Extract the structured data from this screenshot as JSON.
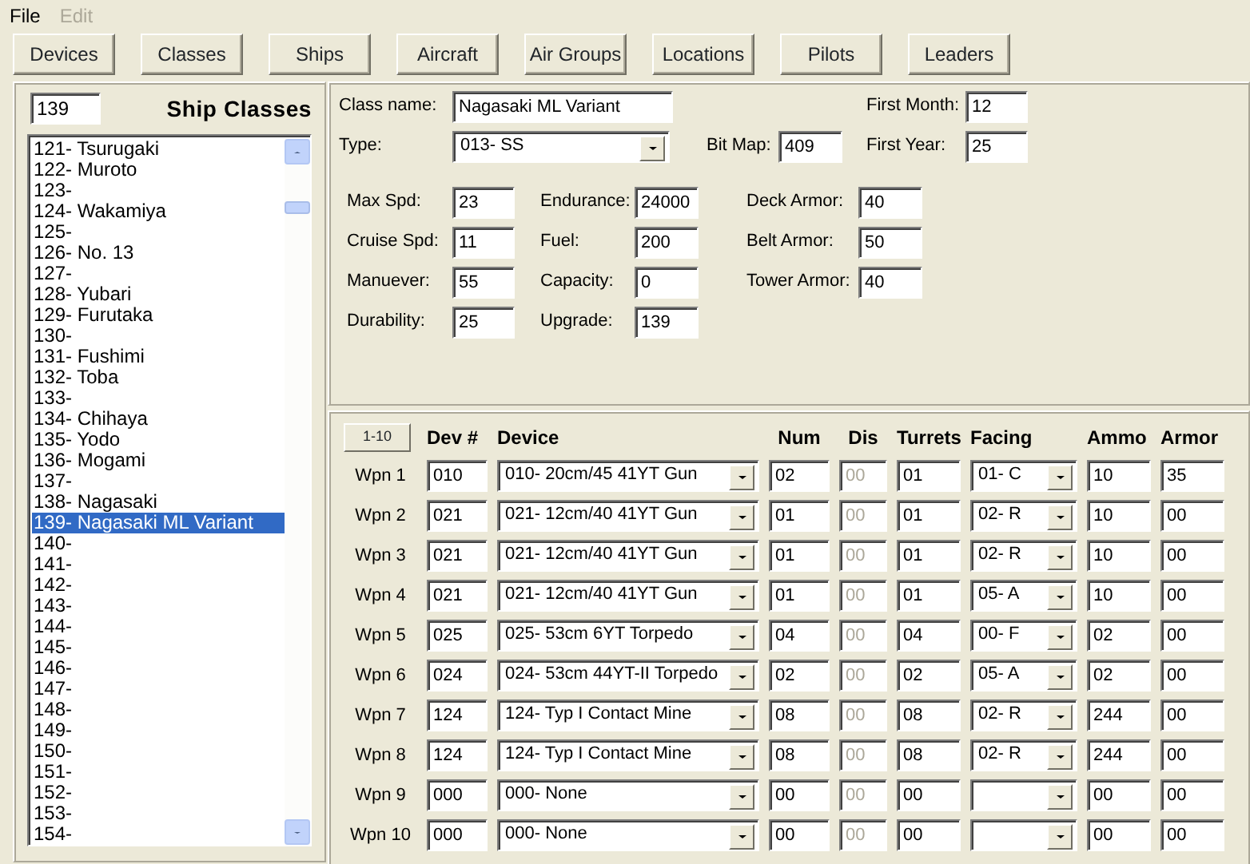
{
  "menu": [
    {
      "label": "File",
      "disabled": false
    },
    {
      "label": "Edit",
      "disabled": true
    }
  ],
  "nav_buttons": [
    "Devices",
    "Classes",
    "Ships",
    "Aircraft",
    "Air Groups",
    "Locations",
    "Pilots",
    "Leaders"
  ],
  "ship_list": {
    "search": "139",
    "title": "Ship Classes",
    "items": [
      {
        "label": "121- Tsurugaki",
        "selected": false
      },
      {
        "label": "122- Muroto",
        "selected": false
      },
      {
        "label": "123-",
        "selected": false
      },
      {
        "label": "124- Wakamiya",
        "selected": false
      },
      {
        "label": "125-",
        "selected": false
      },
      {
        "label": "126- No. 13",
        "selected": false
      },
      {
        "label": "127-",
        "selected": false
      },
      {
        "label": "128- Yubari",
        "selected": false
      },
      {
        "label": "129- Furutaka",
        "selected": false
      },
      {
        "label": "130-",
        "selected": false
      },
      {
        "label": "131- Fushimi",
        "selected": false
      },
      {
        "label": "132- Toba",
        "selected": false
      },
      {
        "label": "133-",
        "selected": false
      },
      {
        "label": "134- Chihaya",
        "selected": false
      },
      {
        "label": "135- Yodo",
        "selected": false
      },
      {
        "label": "136- Mogami",
        "selected": false
      },
      {
        "label": "137-",
        "selected": false
      },
      {
        "label": "138- Nagasaki",
        "selected": false
      },
      {
        "label": "139- Nagasaki ML Variant",
        "selected": true
      },
      {
        "label": "140-",
        "selected": false
      },
      {
        "label": "141-",
        "selected": false
      },
      {
        "label": "142-",
        "selected": false
      },
      {
        "label": "143-",
        "selected": false
      },
      {
        "label": "144-",
        "selected": false
      },
      {
        "label": "145-",
        "selected": false
      },
      {
        "label": "146-",
        "selected": false
      },
      {
        "label": "147-",
        "selected": false
      },
      {
        "label": "148-",
        "selected": false
      },
      {
        "label": "149-",
        "selected": false
      },
      {
        "label": "150-",
        "selected": false
      },
      {
        "label": "151-",
        "selected": false
      },
      {
        "label": "152-",
        "selected": false
      },
      {
        "label": "153-",
        "selected": false
      },
      {
        "label": "154-",
        "selected": false
      }
    ]
  },
  "class_form": {
    "class_name": {
      "label": "Class name:",
      "value": "Nagasaki ML Variant"
    },
    "first_month": {
      "label": "First Month:",
      "value": "12"
    },
    "type": {
      "label": "Type:",
      "value": "013- SS"
    },
    "bit_map": {
      "label": "Bit Map:",
      "value": "409"
    },
    "first_year": {
      "label": "First Year:",
      "value": "25"
    },
    "stats": [
      [
        {
          "label": "Max Spd:",
          "value": "23"
        },
        {
          "label": "Endurance:",
          "value": "24000"
        },
        {
          "label": "Deck Armor:",
          "value": "40"
        }
      ],
      [
        {
          "label": "Cruise Spd:",
          "value": "11"
        },
        {
          "label": "Fuel:",
          "value": "200"
        },
        {
          "label": "Belt Armor:",
          "value": "50"
        }
      ],
      [
        {
          "label": "Manuever:",
          "value": "55"
        },
        {
          "label": "Capacity:",
          "value": "0"
        },
        {
          "label": "Tower Armor:",
          "value": "40"
        }
      ],
      [
        {
          "label": "Durability:",
          "value": "25"
        },
        {
          "label": "Upgrade:",
          "value": "139"
        }
      ]
    ]
  },
  "weapons": {
    "page_button": "1-10",
    "dis_disabled": true,
    "columns": [
      "Dev #",
      "Device",
      "Num",
      "Dis",
      "Turrets",
      "Facing",
      "Ammo",
      "Armor"
    ],
    "rows": [
      {
        "label": "Wpn 1",
        "dev": "010",
        "device": "010- 20cm/45 41YT Gun",
        "num": "02",
        "dis": "00",
        "turrets": "01",
        "facing": "01- C",
        "ammo": "10",
        "armor": "35"
      },
      {
        "label": "Wpn 2",
        "dev": "021",
        "device": "021- 12cm/40 41YT Gun",
        "num": "01",
        "dis": "00",
        "turrets": "01",
        "facing": "02- R",
        "ammo": "10",
        "armor": "00"
      },
      {
        "label": "Wpn 3",
        "dev": "021",
        "device": "021- 12cm/40 41YT Gun",
        "num": "01",
        "dis": "00",
        "turrets": "01",
        "facing": "02- R",
        "ammo": "10",
        "armor": "00"
      },
      {
        "label": "Wpn 4",
        "dev": "021",
        "device": "021- 12cm/40 41YT Gun",
        "num": "01",
        "dis": "00",
        "turrets": "01",
        "facing": "05- A",
        "ammo": "10",
        "armor": "00"
      },
      {
        "label": "Wpn 5",
        "dev": "025",
        "device": "025- 53cm 6YT Torpedo",
        "num": "04",
        "dis": "00",
        "turrets": "04",
        "facing": "00- F",
        "ammo": "02",
        "armor": "00"
      },
      {
        "label": "Wpn 6",
        "dev": "024",
        "device": "024- 53cm 44YT-II Torpedo",
        "num": "02",
        "dis": "00",
        "turrets": "02",
        "facing": "05- A",
        "ammo": "02",
        "armor": "00"
      },
      {
        "label": "Wpn 7",
        "dev": "124",
        "device": "124- Typ I Contact Mine",
        "num": "08",
        "dis": "00",
        "turrets": "08",
        "facing": "02- R",
        "ammo": "244",
        "armor": "00"
      },
      {
        "label": "Wpn 8",
        "dev": "124",
        "device": "124- Typ I Contact Mine",
        "num": "08",
        "dis": "00",
        "turrets": "08",
        "facing": "02- R",
        "ammo": "244",
        "armor": "00"
      },
      {
        "label": "Wpn 9",
        "dev": "000",
        "device": "000- None",
        "num": "00",
        "dis": "00",
        "turrets": "00",
        "ammo": "00",
        "armor": "00"
      },
      {
        "label": "Wpn 10",
        "dev": "000",
        "device": "000- None",
        "num": "00",
        "dis": "00",
        "turrets": "00",
        "ammo": "00",
        "armor": "00"
      }
    ]
  }
}
